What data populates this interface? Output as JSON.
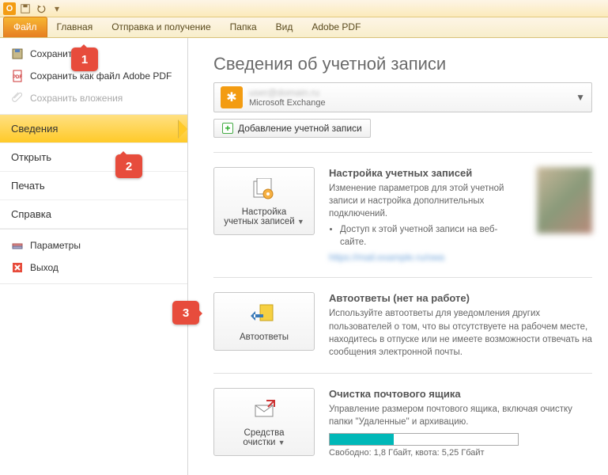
{
  "titlebar": {
    "app_letter": "O"
  },
  "tabs": {
    "file": "Файл",
    "home": "Главная",
    "sendreceive": "Отправка и получение",
    "folder": "Папка",
    "view": "Вид",
    "pdf": "Adobe PDF"
  },
  "side": {
    "save": "Сохранить",
    "save_pdf": "Сохранить как файл Adobe PDF",
    "save_attach": "Сохранить вложения",
    "info": "Сведения",
    "open": "Открыть",
    "print": "Печать",
    "help": "Справка",
    "options": "Параметры",
    "exit": "Выход"
  },
  "main": {
    "title": "Сведения об учетной записи",
    "acct_line1": "user@domain.ru",
    "acct_line2": "Microsoft Exchange",
    "add_acct": "Добавление учетной записи"
  },
  "b1": {
    "tile_l1": "Настройка",
    "tile_l2": "учетных записей",
    "head": "Настройка учетных записей",
    "text": "Изменение параметров для этой учетной записи и настройка дополнительных подключений.",
    "bullet": "Доступ к этой учетной записи на веб-сайте.",
    "link": "https://mail.example.ru/owa"
  },
  "b2": {
    "tile": "Автоответы",
    "head": "Автоответы (нет на работе)",
    "text": "Используйте автоответы для уведомления других пользователей о том, что вы отсутствуете на рабочем месте, находитесь в отпуске или не имеете возможности отвечать на сообщения электронной почты."
  },
  "b3": {
    "tile_l1": "Средства",
    "tile_l2": "очистки",
    "head": "Очистка почтового ящика",
    "text": "Управление размером почтового ящика, включая очистку папки \"Удаленные\" и архивацию.",
    "quota": "Свободно: 1,8 Гбайт, квота: 5,25 Гбайт"
  },
  "callouts": {
    "c1": "1",
    "c2": "2",
    "c3": "3"
  }
}
